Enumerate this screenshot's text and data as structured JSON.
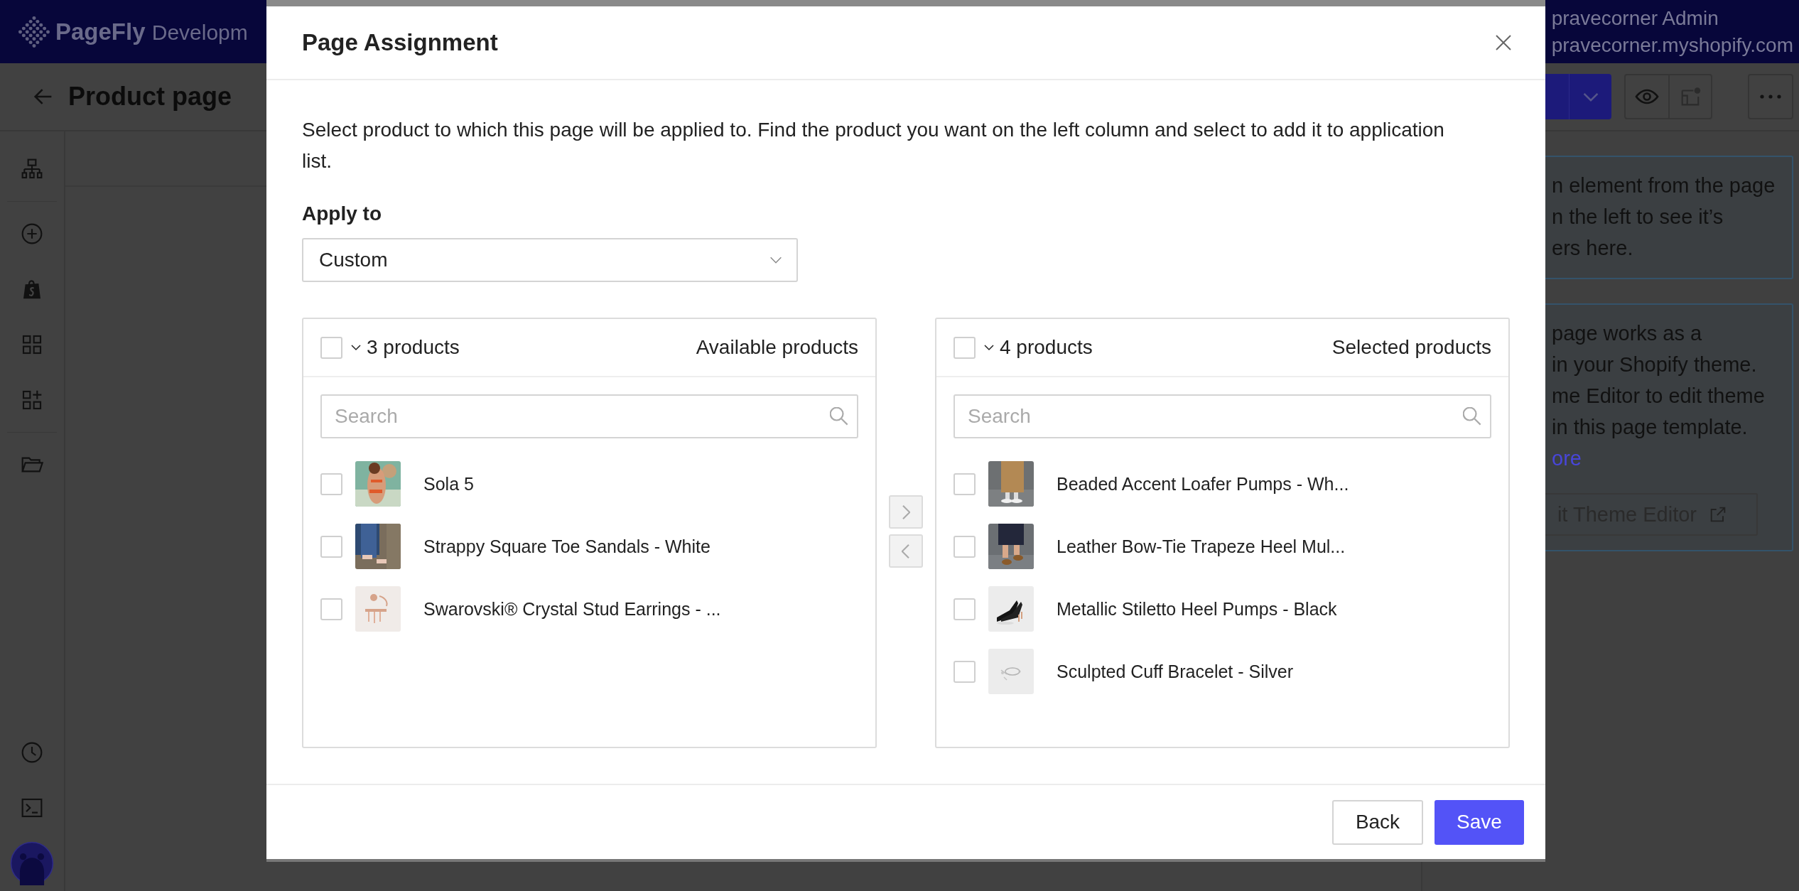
{
  "app_header": {
    "logo_brand": "PageFly",
    "logo_text": "Developm",
    "account_name": "pravecorner Admin",
    "account_domain": "pravecorner.myshopify.com"
  },
  "toolbar": {
    "title": "Product page"
  },
  "right_panel": {
    "info_lines": [
      "n element from the page",
      "n the left to see it’s",
      "ers here."
    ],
    "theme_lines": [
      "page works as a",
      "in your Shopify theme.",
      "me Editor to edit theme",
      "in this page template."
    ],
    "theme_link": "ore",
    "theme_button": "it Theme Editor"
  },
  "dialog": {
    "title": "Page Assignment",
    "description": "Select product to which this page will be applied to. Find the product you want on the left column and select to add it to application list.",
    "apply_to_label": "Apply to",
    "apply_to_value": "Custom",
    "lists": [
      {
        "count": "3 products",
        "title": "Available products",
        "checked": false,
        "search_placeholder": "Search",
        "items": [
          {
            "name": "Sola 5",
            "checked": false
          },
          {
            "name": "Strappy Square Toe Sandals - White",
            "checked": false
          },
          {
            "name": "Swarovski® Crystal Stud Earrings - ...",
            "checked": false
          }
        ]
      },
      {
        "count": "4 products",
        "title": "Selected products",
        "checked": false,
        "search_placeholder": "Search",
        "items": [
          {
            "name": "Beaded Accent Loafer Pumps - Wh...",
            "checked": false
          },
          {
            "name": "Leather Bow-Tie Trapeze Heel Mul...",
            "checked": false
          },
          {
            "name": "Metallic Stiletto Heel Pumps - Black",
            "checked": false
          },
          {
            "name": "Sculpted Cuff Bracelet - Silver",
            "checked": false
          }
        ]
      }
    ],
    "transfer_buttons": [
      {
        "kind": "move_right",
        "disabled": true
      },
      {
        "kind": "move_left",
        "disabled": true
      }
    ],
    "buttons": [
      {
        "label": "Back",
        "kind": "secondary"
      },
      {
        "label": "Save",
        "kind": "primary"
      }
    ]
  }
}
